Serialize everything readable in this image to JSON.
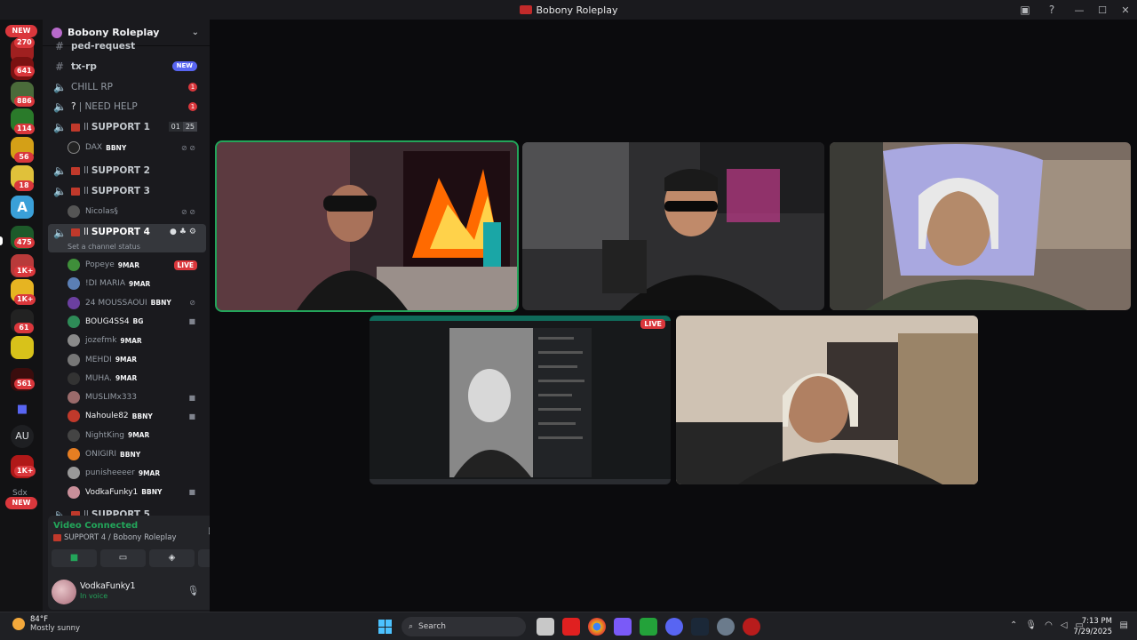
{
  "window": {
    "title": "Bobony Roleplay"
  },
  "rail": {
    "new_top": "NEW",
    "new_bottom": "NEW",
    "badges": [
      "270",
      "641",
      "886",
      "114",
      "56",
      "18",
      "475",
      "1K+",
      "1K+",
      "61",
      "561",
      "1K+"
    ],
    "au_label": "AU",
    "partial_label": "Sdx"
  },
  "guild": {
    "name": "Bobony Roleplay"
  },
  "channels": {
    "ped_request": "ped-request",
    "tx_rp": {
      "name": "tx-rp",
      "badge": "NEW"
    },
    "chill_rp": {
      "name": "CHILL RP",
      "badge": "1"
    },
    "need_help": {
      "name": "| NEED HELP",
      "badge": "1"
    },
    "support1": {
      "name": "SUPPORT 1",
      "count_a": "01",
      "count_b": "25",
      "prefix": "ll"
    },
    "support1_member": {
      "name": "DAX",
      "tag": "BBNY"
    },
    "support2": {
      "name": "SUPPORT 2",
      "prefix": "ll"
    },
    "support3": {
      "name": "SUPPORT 3",
      "prefix": "ll"
    },
    "support3_member": {
      "name": "Nicolas§"
    },
    "support4": {
      "name": "SUPPORT 4",
      "prefix": "ll",
      "status_hint": "Set a channel status"
    },
    "support5": {
      "name": "SUPPORT 5",
      "prefix": "ll"
    }
  },
  "members": [
    {
      "name": "Popeye",
      "tag": "9MAR",
      "live": "LIVE",
      "color": "#3f8f3a"
    },
    {
      "name": "!DI MARIA",
      "tag": "9MAR",
      "color": "#5b7fb5"
    },
    {
      "name": "24 MOUSSAOUI",
      "tag": "BBNY",
      "color": "#6b3fa0"
    },
    {
      "name": "BOUG4SS4",
      "tag": "BG",
      "color": "#2e8b57"
    },
    {
      "name": "jozefmk",
      "tag": "9MAR",
      "color": "#8a8a8a"
    },
    {
      "name": "MEHDI",
      "tag": "9MAR",
      "color": "#777"
    },
    {
      "name": "MUHA.",
      "tag": "9MAR",
      "color": "#333"
    },
    {
      "name": "MUSLIMx333",
      "tag": "",
      "color": "#9a6b6b"
    },
    {
      "name": "Nahoule82",
      "tag": "BBNY",
      "color": "#c0392b"
    },
    {
      "name": "NightKing",
      "tag": "9MAR",
      "color": "#444"
    },
    {
      "name": "ONIGIRI",
      "tag": "BBNY",
      "color": "#e67e22"
    },
    {
      "name": "punisheeeer",
      "tag": "9MAR",
      "color": "#999"
    },
    {
      "name": "VodkaFunky1",
      "tag": "BBNY",
      "color": "#c98f9a"
    }
  ],
  "voice": {
    "status": "Video Connected",
    "location": "SUPPORT 4 / Bobony Roleplay"
  },
  "user": {
    "name": "VodkaFunky1",
    "status": "In voice"
  },
  "stage": {
    "live_label": "LIVE"
  },
  "taskbar": {
    "temp": "84°F",
    "weather": "Mostly sunny",
    "search": "Search",
    "time": "7:13 PM",
    "date": "7/29/2025"
  },
  "colors": {
    "speaking": "#23a55a",
    "badge": "#da373c",
    "accent": "#5865f2"
  }
}
